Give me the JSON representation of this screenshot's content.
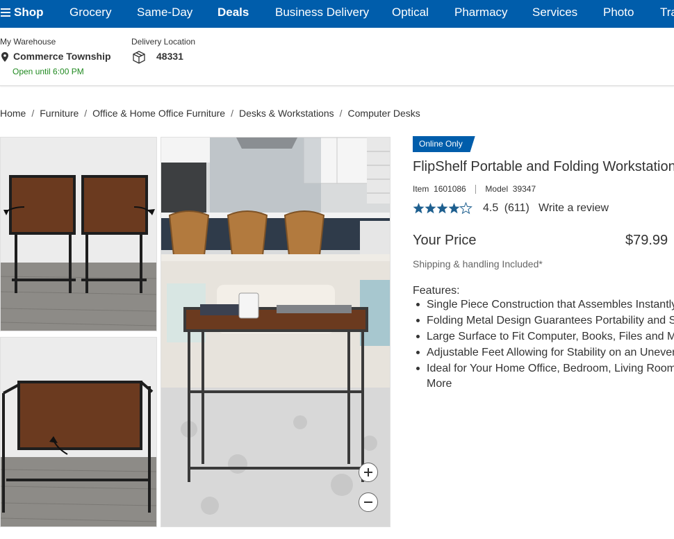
{
  "nav": {
    "shop": "Shop",
    "items": [
      "Grocery",
      "Same-Day",
      "Deals",
      "Business Delivery",
      "Optical",
      "Pharmacy",
      "Services",
      "Photo",
      "Tra"
    ]
  },
  "location": {
    "warehouse_label": "My Warehouse",
    "warehouse_name": "Commerce Township",
    "hours": "Open until 6:00 PM",
    "delivery_label": "Delivery Location",
    "zip": "48331"
  },
  "breadcrumb": [
    "Home",
    "Furniture",
    "Office & Home Office Furniture",
    "Desks & Workstations",
    "Computer Desks"
  ],
  "product": {
    "badge": "Online Only",
    "title": "FlipShelf Portable and Folding Workstation",
    "item_label": "Item",
    "item_number": "1601086",
    "model_label": "Model",
    "model_number": "39347",
    "rating": 4.5,
    "rating_text": "4.5",
    "review_count": "(611)",
    "write_review": "Write a review",
    "price_label": "Your Price",
    "price": "$79.99",
    "shipping": "Shipping & handling Included*",
    "features_title": "Features:",
    "features": [
      "Single Piece Construction that Assembles Instantly",
      "Folding Metal Design Guarantees Portability and Storage",
      "Large Surface to Fit Computer, Books, Files and More",
      "Adjustable Feet Allowing for Stability on an Uneven Surface",
      "Ideal for Your Home Office, Bedroom, Living Room and"
    ],
    "more": "More"
  },
  "colors": {
    "brand_blue": "#005dab",
    "open_green": "#218a21",
    "wood": "#6b3a1f"
  }
}
